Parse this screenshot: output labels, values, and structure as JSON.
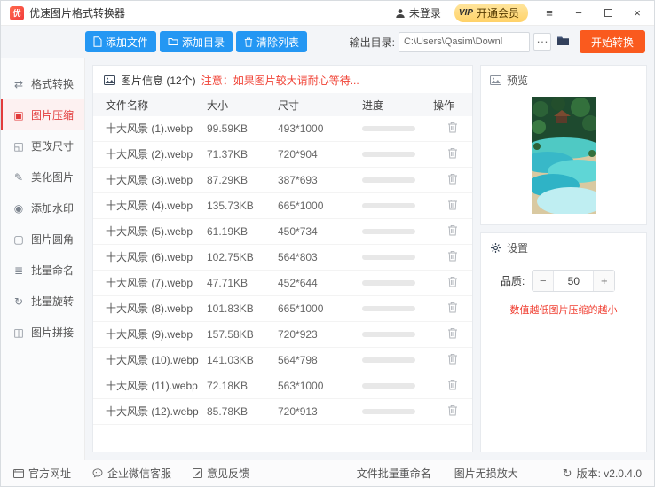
{
  "window": {
    "title": "优速图片格式转换器",
    "logo_glyph": "优"
  },
  "account": {
    "login_status": "未登录",
    "vip_badge": "VIP",
    "vip_label": "开通会员"
  },
  "toolbar": {
    "add_file_label": "添加文件",
    "add_folder_label": "添加目录",
    "clear_list_label": "清除列表",
    "output_dir_label": "输出目录:",
    "output_dir_value": "C:\\Users\\Qasim\\Downl",
    "browse_label": "···",
    "start_convert_label": "开始转换"
  },
  "sidebar": {
    "items": [
      {
        "id": "format-convert",
        "label": "格式转换",
        "icon": "format-convert-icon",
        "active": false
      },
      {
        "id": "image-compress",
        "label": "图片压缩",
        "icon": "compress-icon",
        "active": true
      },
      {
        "id": "resize",
        "label": "更改尺寸",
        "icon": "resize-icon",
        "active": false
      },
      {
        "id": "beautify",
        "label": "美化图片",
        "icon": "beautify-icon",
        "active": false
      },
      {
        "id": "watermark",
        "label": "添加水印",
        "icon": "watermark-icon",
        "active": false
      },
      {
        "id": "rounded-corner",
        "label": "图片圆角",
        "icon": "rounded-corner-icon",
        "active": false
      },
      {
        "id": "batch-rename",
        "label": "批量命名",
        "icon": "batch-rename-icon",
        "active": false
      },
      {
        "id": "batch-rotate",
        "label": "批量旋转",
        "icon": "batch-rotate-icon",
        "active": false
      },
      {
        "id": "stitch",
        "label": "图片拼接",
        "icon": "stitch-icon",
        "active": false
      }
    ]
  },
  "main": {
    "info_title": "图片信息 (12个)",
    "info_warning": "注意：如果图片较大请耐心等待...",
    "table": {
      "columns": [
        "文件名称",
        "大小",
        "尺寸",
        "进度",
        "操作"
      ]
    },
    "files": [
      {
        "name": "十大风景 (1).webp",
        "size": "99.59KB",
        "dims": "493*1000"
      },
      {
        "name": "十大风景 (2).webp",
        "size": "71.37KB",
        "dims": "720*904"
      },
      {
        "name": "十大风景 (3).webp",
        "size": "87.29KB",
        "dims": "387*693"
      },
      {
        "name": "十大风景 (4).webp",
        "size": "135.73KB",
        "dims": "665*1000"
      },
      {
        "name": "十大风景 (5).webp",
        "size": "61.19KB",
        "dims": "450*734"
      },
      {
        "name": "十大风景 (6).webp",
        "size": "102.75KB",
        "dims": "564*803"
      },
      {
        "name": "十大风景 (7).webp",
        "size": "47.71KB",
        "dims": "452*644"
      },
      {
        "name": "十大风景 (8).webp",
        "size": "101.83KB",
        "dims": "665*1000"
      },
      {
        "name": "十大风景 (9).webp",
        "size": "157.58KB",
        "dims": "720*923"
      },
      {
        "name": "十大风景 (10).webp",
        "size": "141.03KB",
        "dims": "564*798"
      },
      {
        "name": "十大风景 (11).webp",
        "size": "72.18KB",
        "dims": "563*1000"
      },
      {
        "name": "十大风景 (12).webp",
        "size": "85.78KB",
        "dims": "720*913"
      }
    ]
  },
  "preview": {
    "title": "预览"
  },
  "settings": {
    "title": "设置",
    "quality_label": "品质:",
    "quality_value": "50",
    "minus_label": "−",
    "plus_label": "+",
    "hint": "数值越低图片压缩的越小"
  },
  "footer": {
    "official_site": "官方网址",
    "wechat_support": "企业微信客服",
    "feedback": "意见反馈",
    "batch_rename": "文件批量重命名",
    "lossless_upscale": "图片无损放大",
    "version": "版本: v2.0.4.0"
  },
  "colors": {
    "accent_blue": "#2497f3",
    "accent_orange": "#fa5a1e",
    "accent_red": "#f04134",
    "vip_gold": "#ffd268"
  }
}
